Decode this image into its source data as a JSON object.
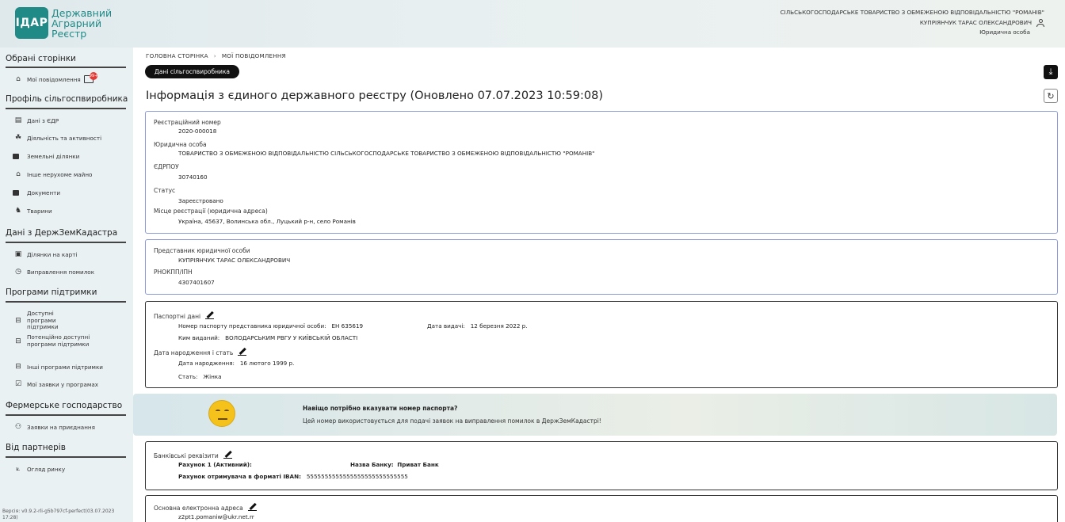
{
  "header": {
    "logo_badge": "ІДАР",
    "logo_line1": "Державний",
    "logo_line2": "Аграрний",
    "logo_line3": "Реєстр",
    "org_name": "СІЛЬСЬКОГОСПОДАРСЬКЕ ТОВАРИСТВО З ОБМЕЖЕНОЮ ВІДПОВІДАЛЬНІСТЮ \"РОМАНІВ\"",
    "user_name": "КУПРІЯНЧУК ТАРАС ОЛЕКСАНДРОВИЧ",
    "user_role": "Юридична особа"
  },
  "sidebar": {
    "sections": [
      {
        "title": "Обрані сторінки",
        "items": [
          {
            "label": "Мої повідомлення",
            "icon": "home-icon",
            "badge": "99+"
          }
        ]
      },
      {
        "title": "Профіль сільгоспвиробника",
        "items": [
          {
            "label": "Дані з ЄДР",
            "icon": "registry-icon"
          },
          {
            "label": "Діяльність та активності",
            "icon": "activity-icon"
          },
          {
            "label": "Земельні ділянки",
            "icon": "land-icon"
          },
          {
            "label": "Інше нерухоме майно",
            "icon": "property-icon"
          },
          {
            "label": "Документи",
            "icon": "documents-icon"
          },
          {
            "label": "Тварини",
            "icon": "animals-icon"
          }
        ]
      },
      {
        "title": "Дані з ДержЗемКадастра",
        "items": [
          {
            "label": "Ділянки на карті",
            "icon": "map-icon"
          },
          {
            "label": "Виправлення помилок",
            "icon": "fix-errors-icon"
          }
        ]
      },
      {
        "title": "Програми підтримки",
        "items": [
          {
            "label": "Доступні програми підтримки",
            "icon": "programs-icon"
          },
          {
            "label": "Потенційно доступні програми підтримки",
            "icon": "programs-potential-icon"
          },
          {
            "label": "Інші програми підтримки",
            "icon": "programs-other-icon"
          },
          {
            "label": "Мої заявки у програмах",
            "icon": "applications-icon"
          }
        ]
      },
      {
        "title": "Фермерське господарство",
        "items": [
          {
            "label": "Заявки на приєднання",
            "icon": "join-requests-icon"
          }
        ]
      },
      {
        "title": "Від партнерів",
        "items": [
          {
            "label": "Огляд ринку",
            "icon": "market-icon"
          }
        ]
      }
    ],
    "version": "Версія: v0.9.2-rli-g5b797cf-perfect(03.07.2023 17:28)"
  },
  "main": {
    "breadcrumb": [
      "ГОЛОВНА СТОРІНКА",
      "МОЇ ПОВІДОМЛЕННЯ"
    ],
    "tab_label": "Дані сільгоспвиробника",
    "title": "Інформація з єдиного державного реєстру (Оновлено 07.07.2023 10:59:08)",
    "registry": {
      "reg_number_label": "Реєстраційний номер",
      "reg_number": "2020-000018",
      "entity_label": "Юридична особа",
      "entity": "ТОВАРИСТВО З ОБМЕЖЕНОЮ ВІДПОВІДАЛЬНІСТЮ СІЛЬСЬКОГОСПОДАРСЬКЕ ТОВАРИСТВО З ОБМЕЖЕНОЮ ВІДПОВІДАЛЬНІСТЮ \"РОМАНІВ\"",
      "edrpou_label": "ЄДРПОУ",
      "edrpou": "30740160",
      "status_label": "Статус",
      "status": "Зареєстровано",
      "address_label": "Місце реєстрації (юридична адреса)",
      "address": "Україна, 45637, Волинська обл., Луцький р-н, село Романів"
    },
    "representative": {
      "label": "Представник юридичної особи",
      "name": "КУПРІЯНЧУК ТАРАС ОЛЕКСАНДРОВИЧ",
      "rnokpp_label": "РНОКПП/ІПН",
      "rnokpp": "4307401607"
    },
    "passport": {
      "label": "Паспортні дані",
      "number_label": "Номер паспорту представника юридичної особи:",
      "number": "ЕН 635619",
      "issue_date_label": "Дата видачі:",
      "issue_date": "12 березня 2022 р.",
      "issued_by_label": "Ким виданий:",
      "issued_by": "ВОЛОДАРСЬКИМ РВГУ У КИЇВСЬКІЙ ОБЛАСТІ",
      "birth_section_label": "Дата народження і стать",
      "birth_label": "Дата народження:",
      "birth": "16 лютого 1999 р.",
      "sex_label": "Стать:",
      "sex": "Жінка"
    },
    "banner": {
      "title": "Навіщо потрібно вказувати номер паспорта?",
      "text": "Цей номер використовується для подачі заявок на виправлення помилок в ДержЗемКадастрі!"
    },
    "bank": {
      "label": "Банківські реквізити",
      "account_label": "Рахунок 1 (Активний):",
      "bank_name_label": "Назва Банку:",
      "bank_name": "Приват Банк",
      "iban_label": "Рахунок отримувача в форматі IBAN:",
      "iban": "5555555555555555555555555555"
    },
    "email": {
      "label": "Основна електронна адреса",
      "value": "z2pt1.pomaniw@ukr.net.rr"
    }
  }
}
